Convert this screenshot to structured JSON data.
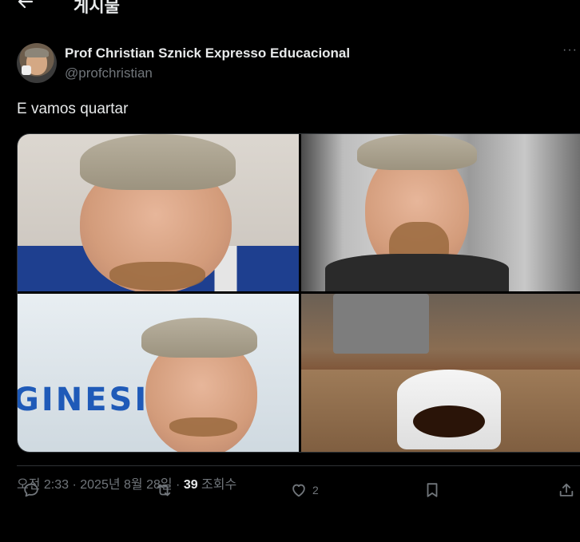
{
  "header": {
    "title": "게시물",
    "back_icon": "arrow-left-icon"
  },
  "post": {
    "author_name": "Prof Christian Sznick Expresso Educacional",
    "author_handle": "@profchristian",
    "more_label": "···",
    "text": "E vamos quartar",
    "timestamp": "오전 2:33 · 2025년 8월 28일 · ",
    "views_count": "39",
    "views_label": " 조회수",
    "photo_logo_text": "GINESI"
  },
  "actions": {
    "reply_icon": "reply-icon",
    "repost_icon": "repost-icon",
    "like_icon": "heart-icon",
    "like_count": "2",
    "bookmark_icon": "bookmark-icon",
    "share_icon": "share-icon"
  },
  "colors": {
    "background": "#000000",
    "text_primary": "#e7e9ea",
    "text_secondary": "#71767b",
    "divider": "#2f3336"
  }
}
